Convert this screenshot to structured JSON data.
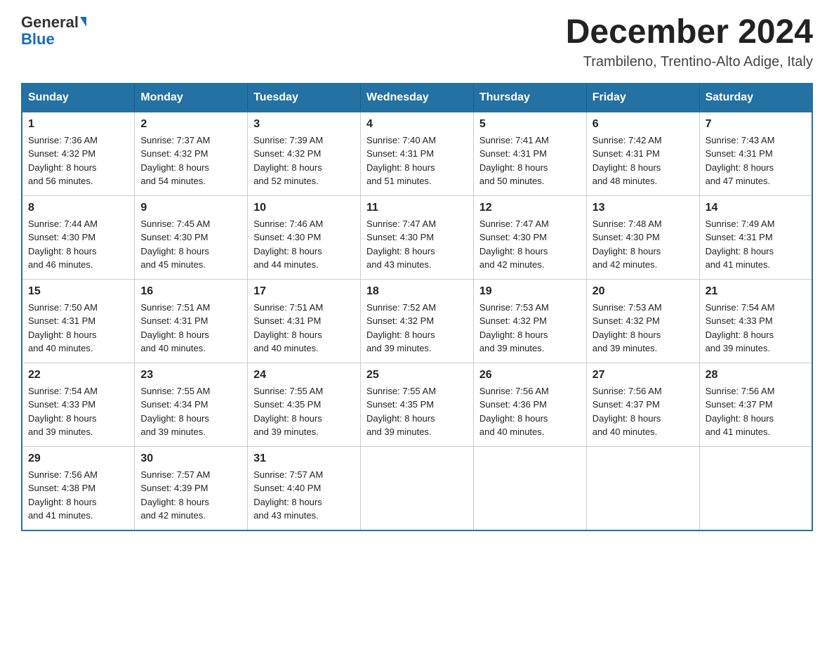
{
  "header": {
    "logo_line1": "General",
    "logo_line2": "Blue",
    "title": "December 2024",
    "subtitle": "Trambileno, Trentino-Alto Adige, Italy"
  },
  "days_of_week": [
    "Sunday",
    "Monday",
    "Tuesday",
    "Wednesday",
    "Thursday",
    "Friday",
    "Saturday"
  ],
  "weeks": [
    [
      {
        "day": "1",
        "sunrise": "7:36 AM",
        "sunset": "4:32 PM",
        "daylight": "8 hours and 56 minutes."
      },
      {
        "day": "2",
        "sunrise": "7:37 AM",
        "sunset": "4:32 PM",
        "daylight": "8 hours and 54 minutes."
      },
      {
        "day": "3",
        "sunrise": "7:39 AM",
        "sunset": "4:32 PM",
        "daylight": "8 hours and 52 minutes."
      },
      {
        "day": "4",
        "sunrise": "7:40 AM",
        "sunset": "4:31 PM",
        "daylight": "8 hours and 51 minutes."
      },
      {
        "day": "5",
        "sunrise": "7:41 AM",
        "sunset": "4:31 PM",
        "daylight": "8 hours and 50 minutes."
      },
      {
        "day": "6",
        "sunrise": "7:42 AM",
        "sunset": "4:31 PM",
        "daylight": "8 hours and 48 minutes."
      },
      {
        "day": "7",
        "sunrise": "7:43 AM",
        "sunset": "4:31 PM",
        "daylight": "8 hours and 47 minutes."
      }
    ],
    [
      {
        "day": "8",
        "sunrise": "7:44 AM",
        "sunset": "4:30 PM",
        "daylight": "8 hours and 46 minutes."
      },
      {
        "day": "9",
        "sunrise": "7:45 AM",
        "sunset": "4:30 PM",
        "daylight": "8 hours and 45 minutes."
      },
      {
        "day": "10",
        "sunrise": "7:46 AM",
        "sunset": "4:30 PM",
        "daylight": "8 hours and 44 minutes."
      },
      {
        "day": "11",
        "sunrise": "7:47 AM",
        "sunset": "4:30 PM",
        "daylight": "8 hours and 43 minutes."
      },
      {
        "day": "12",
        "sunrise": "7:47 AM",
        "sunset": "4:30 PM",
        "daylight": "8 hours and 42 minutes."
      },
      {
        "day": "13",
        "sunrise": "7:48 AM",
        "sunset": "4:30 PM",
        "daylight": "8 hours and 42 minutes."
      },
      {
        "day": "14",
        "sunrise": "7:49 AM",
        "sunset": "4:31 PM",
        "daylight": "8 hours and 41 minutes."
      }
    ],
    [
      {
        "day": "15",
        "sunrise": "7:50 AM",
        "sunset": "4:31 PM",
        "daylight": "8 hours and 40 minutes."
      },
      {
        "day": "16",
        "sunrise": "7:51 AM",
        "sunset": "4:31 PM",
        "daylight": "8 hours and 40 minutes."
      },
      {
        "day": "17",
        "sunrise": "7:51 AM",
        "sunset": "4:31 PM",
        "daylight": "8 hours and 40 minutes."
      },
      {
        "day": "18",
        "sunrise": "7:52 AM",
        "sunset": "4:32 PM",
        "daylight": "8 hours and 39 minutes."
      },
      {
        "day": "19",
        "sunrise": "7:53 AM",
        "sunset": "4:32 PM",
        "daylight": "8 hours and 39 minutes."
      },
      {
        "day": "20",
        "sunrise": "7:53 AM",
        "sunset": "4:32 PM",
        "daylight": "8 hours and 39 minutes."
      },
      {
        "day": "21",
        "sunrise": "7:54 AM",
        "sunset": "4:33 PM",
        "daylight": "8 hours and 39 minutes."
      }
    ],
    [
      {
        "day": "22",
        "sunrise": "7:54 AM",
        "sunset": "4:33 PM",
        "daylight": "8 hours and 39 minutes."
      },
      {
        "day": "23",
        "sunrise": "7:55 AM",
        "sunset": "4:34 PM",
        "daylight": "8 hours and 39 minutes."
      },
      {
        "day": "24",
        "sunrise": "7:55 AM",
        "sunset": "4:35 PM",
        "daylight": "8 hours and 39 minutes."
      },
      {
        "day": "25",
        "sunrise": "7:55 AM",
        "sunset": "4:35 PM",
        "daylight": "8 hours and 39 minutes."
      },
      {
        "day": "26",
        "sunrise": "7:56 AM",
        "sunset": "4:36 PM",
        "daylight": "8 hours and 40 minutes."
      },
      {
        "day": "27",
        "sunrise": "7:56 AM",
        "sunset": "4:37 PM",
        "daylight": "8 hours and 40 minutes."
      },
      {
        "day": "28",
        "sunrise": "7:56 AM",
        "sunset": "4:37 PM",
        "daylight": "8 hours and 41 minutes."
      }
    ],
    [
      {
        "day": "29",
        "sunrise": "7:56 AM",
        "sunset": "4:38 PM",
        "daylight": "8 hours and 41 minutes."
      },
      {
        "day": "30",
        "sunrise": "7:57 AM",
        "sunset": "4:39 PM",
        "daylight": "8 hours and 42 minutes."
      },
      {
        "day": "31",
        "sunrise": "7:57 AM",
        "sunset": "4:40 PM",
        "daylight": "8 hours and 43 minutes."
      },
      null,
      null,
      null,
      null
    ]
  ],
  "labels": {
    "sunrise": "Sunrise:",
    "sunset": "Sunset:",
    "daylight": "Daylight:"
  }
}
